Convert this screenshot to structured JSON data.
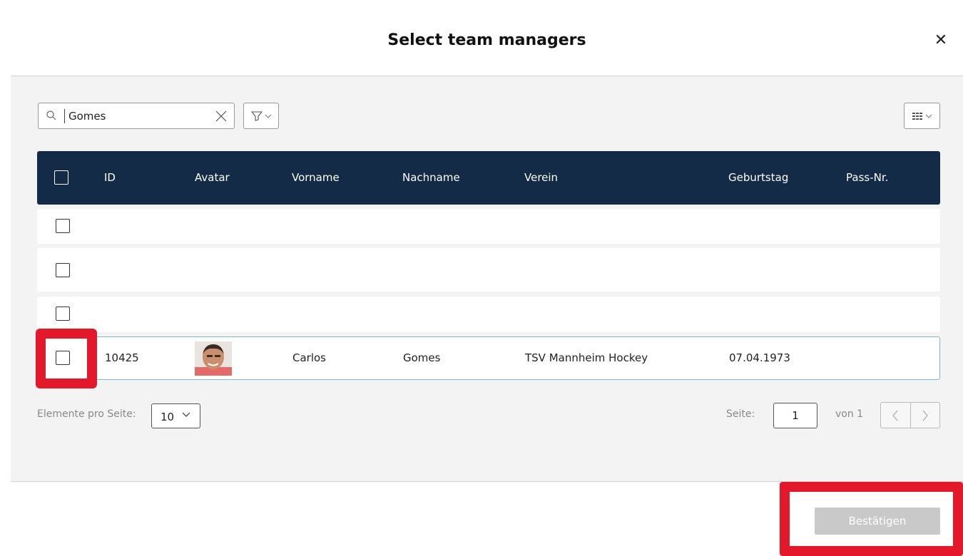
{
  "dialog": {
    "title": "Select team managers",
    "close_icon": "close-icon"
  },
  "search": {
    "value": "Gomes",
    "placeholder": ""
  },
  "table": {
    "columns": [
      "ID",
      "Avatar",
      "Vorname",
      "Nachname",
      "Verein",
      "Geburtstag",
      "Pass-Nr."
    ],
    "rows": [
      {
        "id": "",
        "vorname": "",
        "nachname": "",
        "verein": "",
        "geburtstag": "",
        "pass": ""
      },
      {
        "id": "",
        "vorname": "",
        "nachname": "",
        "verein": "",
        "geburtstag": "",
        "pass": ""
      },
      {
        "id": "",
        "vorname": "",
        "nachname": "",
        "verein": "",
        "geburtstag": "",
        "pass": ""
      },
      {
        "id": "10425",
        "vorname": "Carlos",
        "nachname": "Gomes",
        "verein": "TSV Mannheim Hockey",
        "geburtstag": "07.04.1973",
        "pass": ""
      }
    ]
  },
  "pagination": {
    "per_page_label": "Elemente pro Seite:",
    "per_page_value": "10",
    "page_label": "Seite:",
    "page_value": "1",
    "page_of": "von 1"
  },
  "footer": {
    "confirm_label": "Bestätigen"
  },
  "colors": {
    "header_bg": "#132b47",
    "highlight_red": "#e3182b",
    "disabled_button": "#c9c9c9"
  }
}
